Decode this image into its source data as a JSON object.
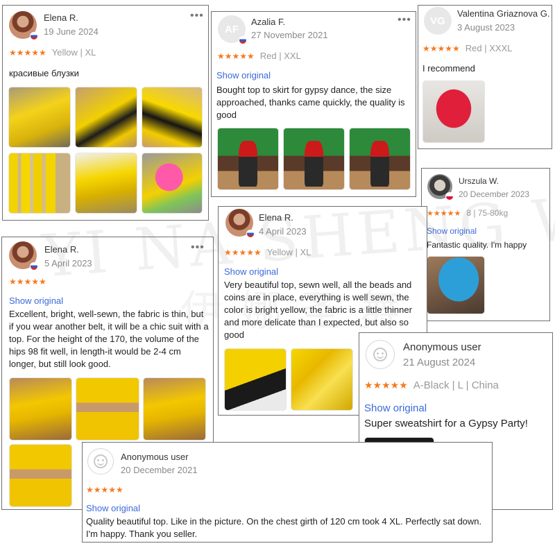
{
  "reviews": [
    {
      "name": "Elena R.",
      "date": "19 June 2024",
      "rating": 5,
      "stars": "★★★★★",
      "meta": "Yellow | XL",
      "text": "красивые блузки",
      "avatar": {
        "type": "photo",
        "flag": "ru"
      },
      "photos": 6
    },
    {
      "name": "Azalia F.",
      "initials": "AF",
      "date": "27 November 2021",
      "rating": 5,
      "stars": "★★★★★",
      "meta": "Red | XXL",
      "show_original": "Show original",
      "text": "Bought top to skirt for gypsy dance, the size approached, thanks came quickly, the quality is good",
      "avatar": {
        "type": "initials",
        "flag": "ru"
      },
      "photos": 3
    },
    {
      "name": "Valentina Griaznova G.",
      "initials": "VG",
      "date": "3 August 2023",
      "rating": 5,
      "stars": "★★★★★",
      "meta": "Red | XXXL",
      "text": "I recommend",
      "avatar": {
        "type": "initials"
      },
      "photos": 1
    },
    {
      "name": "Urszula W.",
      "date": "20 December 2023",
      "rating": 5,
      "stars": "★★★★★",
      "meta": "8 | 75-80kg",
      "show_original": "Show original",
      "text": "Fantastic quality. I'm happy",
      "avatar": {
        "type": "photo",
        "flag": "pl"
      },
      "photos": 1
    },
    {
      "name": "Elena R.",
      "date": "5 April 2023",
      "rating": 5,
      "stars": "★★★★★",
      "show_original": "Show original",
      "text": "Excellent, bright, well-sewn, the fabric is thin, but if you wear another belt, it will be a chic suit with a top. For the height of the 170, the volume of the hips 98 fit well, in length-it would be 2-4 cm longer, but still look good.",
      "avatar": {
        "type": "photo",
        "flag": "ru"
      },
      "photos": 4
    },
    {
      "name": "Elena R.",
      "date": "4 April 2023",
      "rating": 5,
      "stars": "★★★★★",
      "meta": "Yellow | XL",
      "show_original": "Show original",
      "text": "Very beautiful top, sewn well, all the beads and coins are in place, everything is well sewn, the color is bright yellow, the fabric is a little thinner and more delicate than I expected, but also so good",
      "avatar": {
        "type": "photo",
        "flag": "ru"
      },
      "photos": 2
    },
    {
      "name": "Anonymous user",
      "date": "21 August 2024",
      "rating": 5,
      "stars": "★★★★★",
      "meta": "A-Black | L | China",
      "show_original": "Show original",
      "text": "Super sweatshirt for a Gypsy Party!",
      "avatar": {
        "type": "anonymous"
      },
      "photos": 1
    },
    {
      "name": "Anonymous user",
      "date": "20 December 2021",
      "rating": 5,
      "stars": "★★★★★",
      "show_original": "Show original",
      "text": "Quality beautiful top. Like in the picture. On the chest girth of 120 cm took 4 XL. Perfectly sat down. I'm happy. Thank you seller.",
      "avatar": {
        "type": "anonymous"
      },
      "photos": 0
    }
  ],
  "menu_glyph": "•••",
  "watermark": {
    "latin": "YI NA SHENG WU",
    "cjk": "伊娜圣舞"
  }
}
